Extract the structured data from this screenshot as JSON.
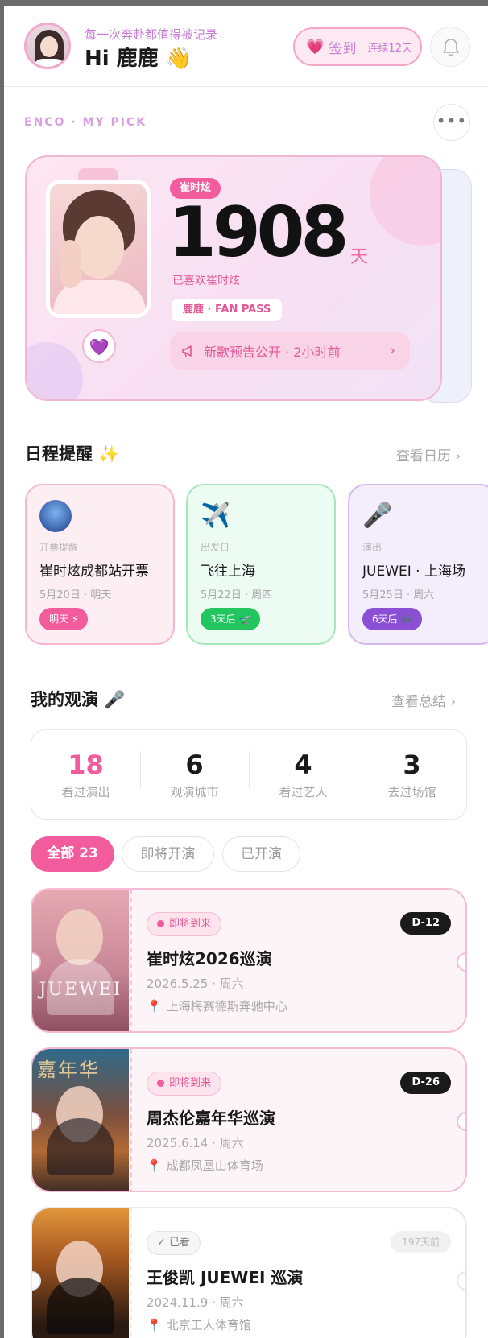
{
  "header": {
    "slogan": "每一次奔赴都值得被记录",
    "greeting": "Hi 鹿鹿 👋",
    "signin": {
      "icon": "💗",
      "label": "签到",
      "streak": "连续12天"
    }
  },
  "section_label": "ENCO · MY PICK",
  "more_label": "•••",
  "fan_card": {
    "artist_tag": "崔时炫",
    "days": "1908",
    "days_unit": "天",
    "liked_text": "已喜欢崔时炫",
    "pass": "鹿鹿 · FAN PASS",
    "heart": "💜",
    "news": "新歌预告公开 · 2小时前",
    "news_chevron": "›"
  },
  "schedule": {
    "title": "日程提醒 ✨",
    "link": "查看日历 ›",
    "items": [
      {
        "icon": "",
        "kind": "开票提醒",
        "title": "崔时炫成都站开票",
        "date": "5月20日 · 明天",
        "chip": "明天 ⚡"
      },
      {
        "icon": "✈️",
        "kind": "出发日",
        "title": "飞往上海",
        "date": "5月22日 · 周四",
        "chip": "3天后 🛫"
      },
      {
        "icon": "🎤",
        "kind": "演出",
        "title": "JUEWEI · 上海场",
        "date": "5月25日 · 周六",
        "chip": "6天后 🎶"
      }
    ]
  },
  "shows": {
    "title": "我的观演 🎤",
    "link": "查看总结 ›",
    "stats": [
      {
        "value": "18",
        "label": "看过演出"
      },
      {
        "value": "6",
        "label": "观演城市"
      },
      {
        "value": "4",
        "label": "看过艺人"
      },
      {
        "value": "3",
        "label": "去过场馆"
      }
    ],
    "filters": [
      "全部 23",
      "即将开演",
      "已开演"
    ],
    "tickets": [
      {
        "status": "即将到来",
        "badge": "D-12",
        "title": "崔时炫2026巡演",
        "date": "2026.5.25 · 周六",
        "venue": "上海梅赛德斯奔驰中心",
        "poster_text": "JUEWEI"
      },
      {
        "status": "即将到来",
        "badge": "D-26",
        "title": "周杰伦嘉年华巡演",
        "date": "2025.6.14 · 周六",
        "venue": "成都凤凰山体育场",
        "poster_text": "嘉年华"
      },
      {
        "status": "✓ 已看",
        "badge": "197天前",
        "title": "王俊凯 JUEWEI 巡演",
        "date": "2024.11.9 · 周六",
        "venue": "北京工人体育馆",
        "poster_text": ""
      }
    ]
  },
  "icons": {
    "venue_pin": "📍",
    "bell": "bell-icon"
  },
  "colors": {
    "accent_pink": "#f25b9c",
    "lilac": "#c77ad6",
    "green": "#22c55e",
    "purple": "#8b4fd6"
  }
}
